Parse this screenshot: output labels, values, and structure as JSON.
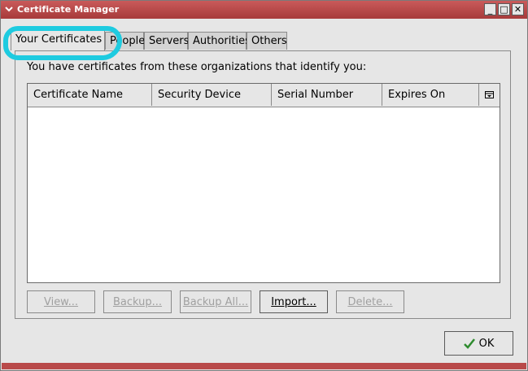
{
  "window": {
    "title": "Certificate Manager",
    "minimize_glyph": "_",
    "maximize_glyph": "□",
    "close_glyph": "✕"
  },
  "tabs": [
    {
      "label": "Your Certificates",
      "active": true
    },
    {
      "label": "People",
      "active": false
    },
    {
      "label": "Servers",
      "active": false
    },
    {
      "label": "Authorities",
      "active": false
    },
    {
      "label": "Others",
      "active": false
    }
  ],
  "panel": {
    "intro_text": "You have certificates from these organizations that identify you:"
  },
  "table": {
    "columns": [
      "Certificate Name",
      "Security Device",
      "Serial Number",
      "Expires On"
    ],
    "rows": []
  },
  "buttons": {
    "view": "View...",
    "backup": "Backup...",
    "backup_all": "Backup All...",
    "import": "Import...",
    "delete": "Delete..."
  },
  "footer": {
    "ok_label": "OK"
  },
  "colors": {
    "titlebar": "#b94a4a",
    "highlight": "#1ecbe0"
  }
}
